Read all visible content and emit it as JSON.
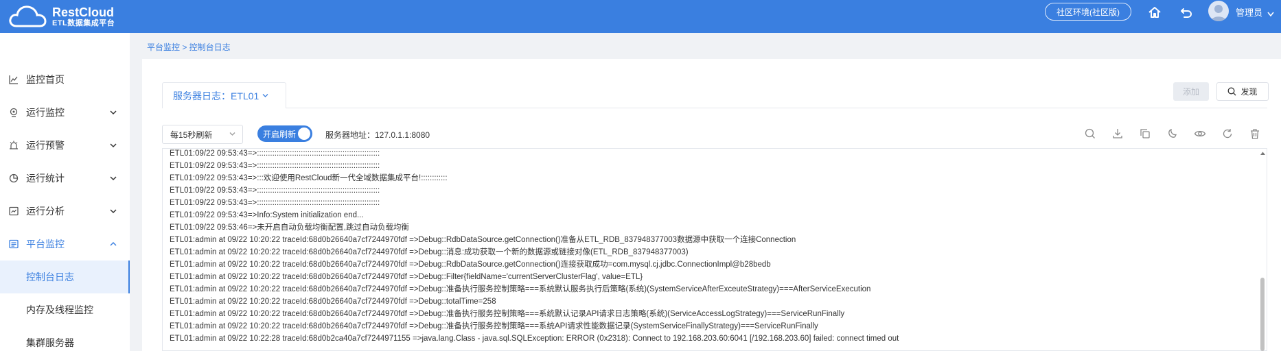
{
  "app": {
    "brand": "RestCloud",
    "subtitle": "ETL数据集成平台"
  },
  "header": {
    "env_label": "社区环境(社区版)",
    "home_icon": "home-icon",
    "back_icon": "undo-icon",
    "user_name": "管理员",
    "colors": {
      "header_bg": "#3a7fe0",
      "accent": "#3a7fe0"
    }
  },
  "sidebar": {
    "items": [
      {
        "label": "监控首页",
        "icon": "line-chart-icon",
        "expandable": false
      },
      {
        "label": "运行监控",
        "icon": "monitor-icon",
        "expandable": true
      },
      {
        "label": "运行预警",
        "icon": "alarm-icon",
        "expandable": true
      },
      {
        "label": "运行统计",
        "icon": "pie-chart-icon",
        "expandable": true
      },
      {
        "label": "运行分析",
        "icon": "analysis-icon",
        "expandable": true
      },
      {
        "label": "平台监控",
        "icon": "monitor-panel-icon",
        "expandable": true,
        "expanded": true
      }
    ],
    "sub_items": [
      {
        "label": "控制台日志",
        "selected": true
      },
      {
        "label": "内存及线程监控",
        "selected": false
      },
      {
        "label": "集群服务器",
        "selected": false
      }
    ]
  },
  "breadcrumb": "平台监控 > 控制台日志",
  "tab": {
    "label": "服务器日志：ETL01"
  },
  "actions": {
    "add_label": "添加",
    "find_label": "发现"
  },
  "controls": {
    "refresh_select": "每15秒刷新",
    "auto_refresh_label": "开启刷新",
    "auto_refresh_on": true,
    "server_address": "服务器地址：127.0.1.1:8080",
    "toolbar_icons": [
      "search-icon",
      "download-icon",
      "copy-icon",
      "moon-icon",
      "eye-icon",
      "refresh-icon",
      "trash-icon"
    ]
  },
  "log_lines": [
    "ETL01:09/22 09:53:43=>::::::::::::::::::::::::::::::::::::::::::::::::::::::::",
    "ETL01:09/22 09:53:43=>::::::::::::::::::::::::::::::::::::::::::::::::::::::::",
    "ETL01:09/22 09:53:43=>:::欢迎使用RestCloud新一代全域数据集成平台!::::::::::::",
    "ETL01:09/22 09:53:43=>::::::::::::::::::::::::::::::::::::::::::::::::::::::::",
    "ETL01:09/22 09:53:43=>::::::::::::::::::::::::::::::::::::::::::::::::::::::::",
    "ETL01:09/22 09:53:43=>Info:System initialization end...",
    "ETL01:09/22 09:53:46=>未开启自动负载均衡配置,跳过自动负载均衡",
    "ETL01:admin at 09/22 10:20:22 traceId:68d0b26640a7cf7244970fdf =>Debug::RdbDataSource.getConnection()准备从ETL_RDB_837948377003数据源中获取一个连接Connection",
    "ETL01:admin at 09/22 10:20:22 traceId:68d0b26640a7cf7244970fdf =>Debug::消息:成功获取一个新的数据源或链接对像(ETL_RDB_837948377003)",
    "ETL01:admin at 09/22 10:20:22 traceId:68d0b26640a7cf7244970fdf =>Debug::RdbDataSource.getConnection()连接获取成功=com.mysql.cj.jdbc.ConnectionImpl@b28bedb",
    "ETL01:admin at 09/22 10:20:22 traceId:68d0b26640a7cf7244970fdf =>Debug::Filter{fieldName='currentServerClusterFlag', value=ETL}",
    "ETL01:admin at 09/22 10:20:22 traceId:68d0b26640a7cf7244970fdf =>Debug::准备执行服务控制策略===系统默认服务执行后策略(系统)(SystemServiceAfterExceuteStrategy)===AfterServiceExecution",
    "ETL01:admin at 09/22 10:20:22 traceId:68d0b26640a7cf7244970fdf =>Debug::totalTime=258",
    "ETL01:admin at 09/22 10:20:22 traceId:68d0b26640a7cf7244970fdf =>Debug::准备执行服务控制策略===系统默认记录API请求日志策略(系统)(ServiceAccessLogStrategy)===ServiceRunFinally",
    "ETL01:admin at 09/22 10:20:22 traceId:68d0b26640a7cf7244970fdf =>Debug::准备执行服务控制策略===系统API请求性能数据记录(SystemServiceFinallyStrategy)===ServiceRunFinally",
    "ETL01:admin at 09/22 10:22:28 traceId:68d0b2ca40a7cf7244971155 =>java.lang.Class - java.sql.SQLException: ERROR (0x2318): Connect to 192.168.203.60:6041 [/192.168.203.60] failed: connect timed out"
  ]
}
